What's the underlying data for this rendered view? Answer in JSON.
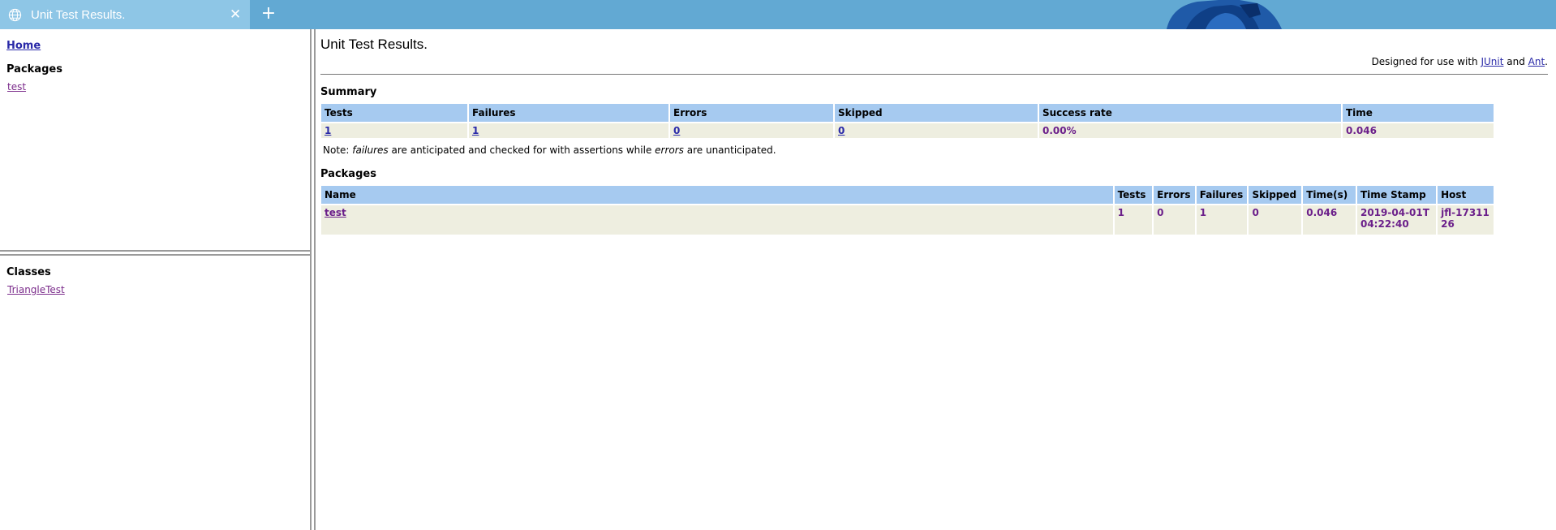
{
  "browser": {
    "tab_title": "Unit Test Results.",
    "close_glyph": "✕",
    "newtab_glyph": "+",
    "icons": {
      "tab": "globe-icon",
      "close": "close-icon",
      "newtab": "plus-icon"
    },
    "colors": {
      "tabbar": "#62a9d3",
      "active_tab": "#8ec6e6"
    }
  },
  "nav": {
    "home": "Home",
    "packages_heading": "Packages",
    "packages": [
      "test"
    ],
    "classes_heading": "Classes",
    "classes": [
      "TriangleTest"
    ]
  },
  "main": {
    "title": "Unit Test Results.",
    "designed_prefix": "Designed for use with ",
    "designed_junit": "JUnit",
    "designed_and": " and ",
    "designed_ant": "Ant",
    "designed_suffix": ".",
    "summary": {
      "heading": "Summary",
      "headers": [
        "Tests",
        "Failures",
        "Errors",
        "Skipped",
        "Success rate",
        "Time"
      ],
      "row": {
        "tests": "1",
        "failures": "1",
        "errors": "0",
        "skipped": "0",
        "success_rate": "0.00%",
        "time": "0.046"
      }
    },
    "note": {
      "prefix": "Note: ",
      "failures": "failures",
      "middle": " are anticipated and checked for with assertions while ",
      "errors": "errors",
      "suffix": " are unanticipated."
    },
    "packages": {
      "heading": "Packages",
      "headers": [
        "Name",
        "Tests",
        "Errors",
        "Failures",
        "Skipped",
        "Time(s)",
        "Time Stamp",
        "Host"
      ],
      "rows": [
        {
          "name": "test",
          "tests": "1",
          "errors": "0",
          "failures": "1",
          "skipped": "0",
          "time": "0.046",
          "timestamp": "2019-04-01T04:22:40",
          "host": "jfl-1731126"
        }
      ]
    },
    "colors": {
      "header_bg": "#a6caf0",
      "row_bg": "#eeeee0",
      "value_text": "#6b1f8a"
    }
  }
}
